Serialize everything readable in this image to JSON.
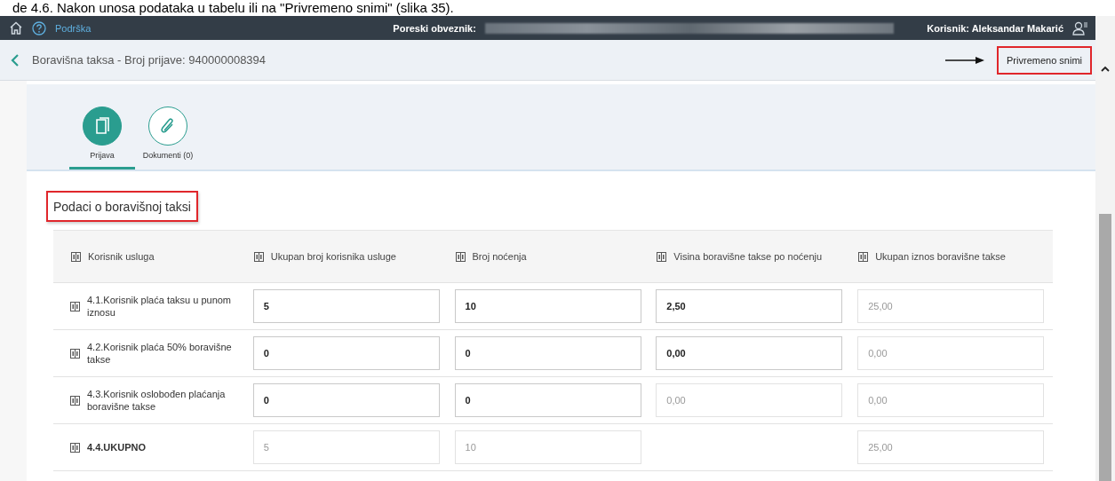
{
  "caption_fragment": "de 4.6. Nakon unosa podataka u tabelu ili na \"Privremeno snimi\" (slika 35).",
  "top_bar": {
    "help_label": "Podrška",
    "taxpayer_label": "Poreski obveznik:",
    "user_label": "Korisnik: Aleksandar Makarić"
  },
  "header": {
    "title": "Boravišna taksa - Broj prijave: 940000008394",
    "save_button": "Privremeno snimi"
  },
  "tabs": [
    {
      "label": "Prijava",
      "selected": true
    },
    {
      "label": "Dokumenti (0)",
      "selected": false
    }
  ],
  "section_title": "Podaci o boravišnoj taksi",
  "table": {
    "columns": [
      "Korisnik usluga",
      "Ukupan broj korisnika usluge",
      "Broj noćenja",
      "Visina boravišne takse po noćenju",
      "Ukupan iznos boravišne takse"
    ],
    "rows": [
      {
        "total": false,
        "cells": [
          {
            "kind": "label",
            "value": "4.1.Korisnik plaća taksu u punom iznosu"
          },
          {
            "kind": "input",
            "value": "5"
          },
          {
            "kind": "input",
            "value": "10"
          },
          {
            "kind": "input",
            "value": "2,50"
          },
          {
            "kind": "readonly",
            "value": "25,00"
          }
        ]
      },
      {
        "total": false,
        "cells": [
          {
            "kind": "label",
            "value": "4.2.Korisnik plaća 50% boravišne takse"
          },
          {
            "kind": "input",
            "value": "0"
          },
          {
            "kind": "input",
            "value": "0"
          },
          {
            "kind": "input",
            "value": "0,00"
          },
          {
            "kind": "readonly",
            "value": "0,00"
          }
        ]
      },
      {
        "total": false,
        "cells": [
          {
            "kind": "label",
            "value": "4.3.Korisnik oslobođen plaćanja boravišne takse"
          },
          {
            "kind": "input",
            "value": "0"
          },
          {
            "kind": "input",
            "value": "0"
          },
          {
            "kind": "readonly",
            "value": "0,00"
          },
          {
            "kind": "readonly",
            "value": "0,00"
          }
        ]
      },
      {
        "total": true,
        "cells": [
          {
            "kind": "label",
            "value": "4.4.UKUPNO"
          },
          {
            "kind": "readonly",
            "value": "5"
          },
          {
            "kind": "readonly",
            "value": "10"
          },
          {
            "kind": "blank"
          },
          {
            "kind": "readonly",
            "value": "25,00"
          }
        ]
      }
    ]
  }
}
